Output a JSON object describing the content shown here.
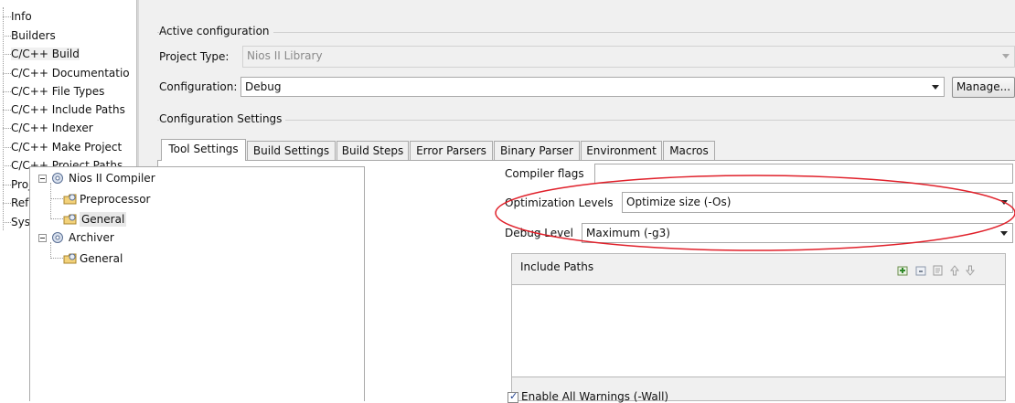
{
  "nav": {
    "items": [
      {
        "label": "Info"
      },
      {
        "label": "Builders"
      },
      {
        "label": "C/C++ Build",
        "selected": true
      },
      {
        "label": "C/C++ Documentatio"
      },
      {
        "label": "C/C++ File Types"
      },
      {
        "label": "C/C++ Include Paths"
      },
      {
        "label": "C/C++ Indexer"
      },
      {
        "label": "C/C++ Make Project"
      },
      {
        "label": "C/C++ Project Paths"
      },
      {
        "label": "Project References"
      },
      {
        "label": "Refactoring History"
      },
      {
        "label": "System Library"
      }
    ]
  },
  "active_configuration": {
    "title": "Active configuration",
    "project_type_label": "Project Type:",
    "project_type_value": "Nios II Library",
    "configuration_label": "Configuration:",
    "configuration_value": "Debug",
    "manage_label": "Manage..."
  },
  "configuration_settings": {
    "title": "Configuration Settings",
    "tabs": [
      {
        "label": "Tool Settings",
        "active": true
      },
      {
        "label": "Build Settings"
      },
      {
        "label": "Build Steps"
      },
      {
        "label": "Error Parsers"
      },
      {
        "label": "Binary Parser"
      },
      {
        "label": "Environment"
      },
      {
        "label": "Macros"
      }
    ]
  },
  "tool_tree": {
    "compiler": "Nios II Compiler",
    "preprocessor": "Preprocessor",
    "compiler_general": "General",
    "archiver": "Archiver",
    "archiver_general": "General"
  },
  "compiler_settings": {
    "compiler_flags_label": "Compiler flags",
    "compiler_flags_value": "",
    "optimization_label": "Optimization Levels",
    "optimization_value": "Optimize size (-Os)",
    "debug_label": "Debug Level",
    "debug_value": "Maximum (-g3)",
    "include_paths_title": "Include Paths",
    "enable_warnings_label": "Enable All Warnings (-Wall)",
    "enable_warnings_checked": true
  },
  "colors": {
    "annotation": "#e0202a",
    "panel_bg": "#f0f0f0",
    "content_bg": "#ffffff"
  }
}
